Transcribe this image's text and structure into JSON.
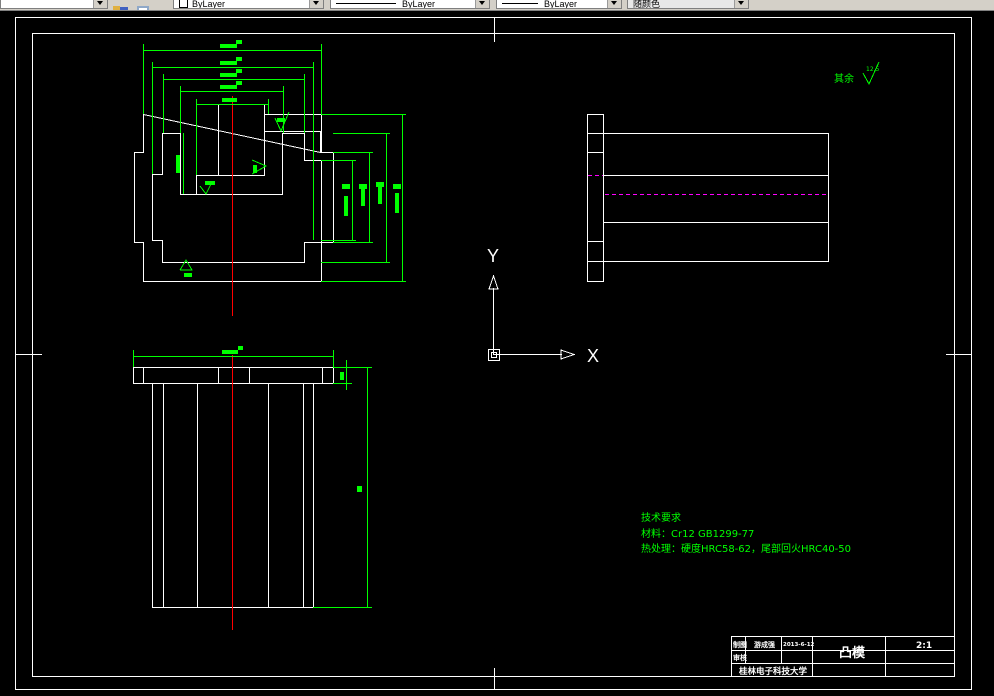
{
  "toolbar": {
    "color_combo": "ByLayer",
    "linetype_combo": "ByLayer",
    "lineweight_combo": "ByLayer",
    "plotstyle_combo": "随颜色"
  },
  "colors": {
    "background": "#000000",
    "geometry": "#ffffff",
    "dimension": "#00ff00",
    "centerline": "#ff0000",
    "hidden_line": "#ff00ff"
  },
  "drawing": {
    "roughness_note": "其余",
    "roughness_value": "12.5",
    "tech_requirements": {
      "heading": "技术要求",
      "material": "材料：Cr12 GB1299-77",
      "heat_treatment": "热处理：硬度HRC58-62，尾部回火HRC40-50"
    },
    "title_block": {
      "drawn_by_label": "制图",
      "drawer_name": "游成强",
      "date": "2013-6-12",
      "checked_by_label": "审核",
      "part_name": "凸模",
      "scale": "2:1",
      "school": "桂林电子科技大学"
    }
  },
  "ucs": {
    "x_label": "X",
    "y_label": "Y"
  }
}
